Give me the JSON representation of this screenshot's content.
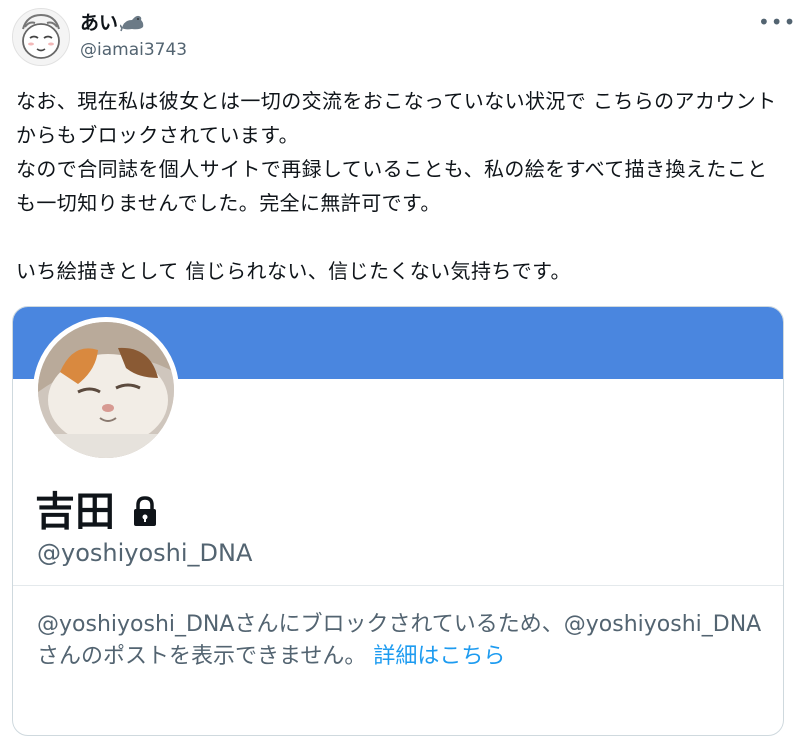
{
  "post": {
    "author_name": "あい",
    "author_handle": "@iamai3743",
    "author_badge_icon": "seal-emoji",
    "more_icon": "more-horizontal-icon",
    "text": "なお、現在私は彼女とは一切の交流をおこなっていない状況で こちらのアカウントからもブロックされています。\nなので合同誌を個人サイトで再録していることも、私の絵をすべて描き換えたことも一切知りませんでした。完全に無許可です。\n\nいち絵描きとして 信じられない、信じたくない気持ちです。"
  },
  "card": {
    "banner_color": "#4a86df",
    "name": "吉田",
    "lock_icon": "lock-icon",
    "handle": "@yoshiyoshi_DNA",
    "notice_part1": "@yoshiyoshi_DNAさんにブロックされているため、@yoshiyoshi_DNAさんのポストを表示できません。",
    "notice_link": "詳細はこちら"
  },
  "colors": {
    "accent": "#1d9bf0",
    "secondary_text": "#536471",
    "border": "#cfd9de"
  }
}
